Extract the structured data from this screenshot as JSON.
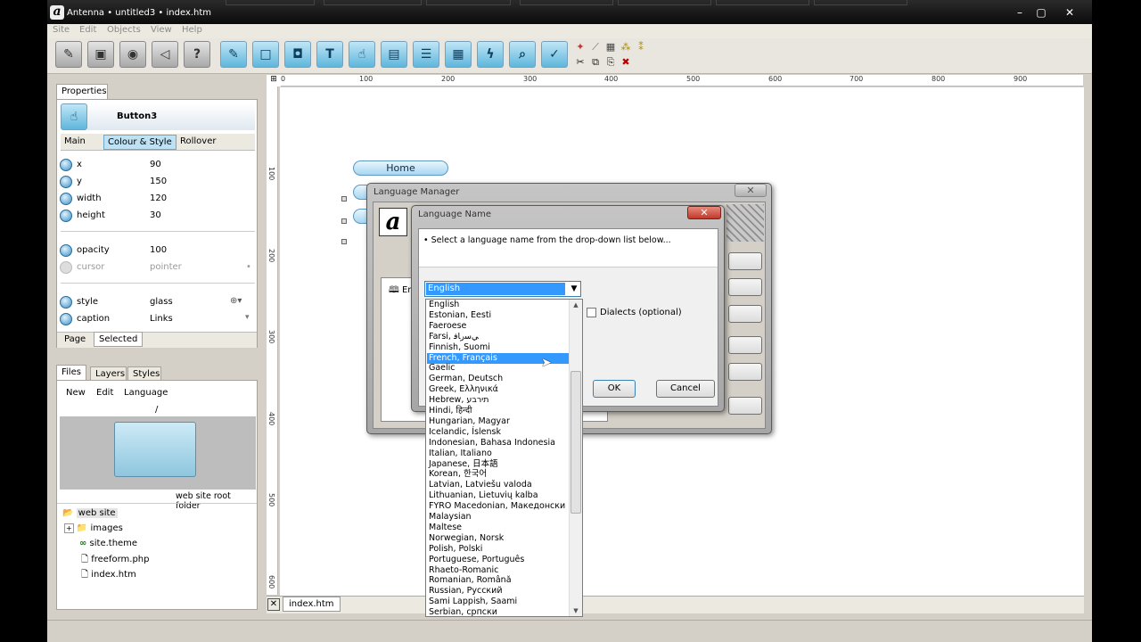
{
  "window": {
    "title": "Antenna • untitled3 • index.htm",
    "controls": [
      "–",
      "▢",
      "✕"
    ]
  },
  "menu": [
    "Site",
    "Edit",
    "Objects",
    "View",
    "Help"
  ],
  "toolbar": {
    "buttons": [
      "publish",
      "save",
      "preview",
      "back",
      "help",
      "pencil",
      "frame",
      "image",
      "text",
      "button",
      "window",
      "list",
      "media",
      "flash",
      "search",
      "form"
    ]
  },
  "properties": {
    "panel_tab": "Properties",
    "object_name": "Button3",
    "tabs": [
      "Main",
      "Colour & Style",
      "Rollover"
    ],
    "rows": [
      {
        "label": "x",
        "value": "90"
      },
      {
        "label": "y",
        "value": "150"
      },
      {
        "label": "width",
        "value": "120"
      },
      {
        "label": "height",
        "value": "30"
      },
      {
        "label": "opacity",
        "value": "100"
      },
      {
        "label": "cursor",
        "value": "pointer"
      },
      {
        "label": "style",
        "value": "glass"
      },
      {
        "label": "caption",
        "value": "Links"
      }
    ],
    "bottom_tabs": [
      "Page",
      "Selected"
    ]
  },
  "files_panel": {
    "tabs": [
      "Files",
      "Layers",
      "Styles"
    ],
    "menu": [
      "New",
      "Edit",
      "Language"
    ],
    "path": "/",
    "folder_caption": "web site root folder",
    "tree": [
      "web site",
      "images",
      "site.theme",
      "freeform.php",
      "index.htm"
    ]
  },
  "ruler": {
    "h": [
      "0",
      "100",
      "200",
      "300",
      "400",
      "500",
      "600",
      "700",
      "800",
      "900"
    ],
    "v": [
      "100",
      "200",
      "300",
      "400",
      "500",
      "600"
    ]
  },
  "canvas": {
    "nav_button": "Home",
    "doc_tab": "index.htm"
  },
  "language_manager": {
    "title": "Language Manager",
    "list_item": "Engl"
  },
  "language_name": {
    "title": "Language Name",
    "instruction": "• Select a language name from the drop-down list below...",
    "selected": "English",
    "dialects_label": "Dialects (optional)",
    "ok": "OK",
    "cancel": "Cancel"
  },
  "languages": [
    "English",
    "Estonian, Eesti",
    "Faeroese",
    "Farsi, ﻲﺳﺭﺎﻓ",
    "Finnish, Suomi",
    "French, Français",
    "Gaelic",
    "German, Deutsch",
    "Greek, Ελληνικά",
    "Hebrew, תירבע",
    "Hindi, हिन्दी",
    "Hungarian, Magyar",
    "Icelandic, Íslensk",
    "Indonesian, Bahasa Indonesia",
    "Italian, Italiano",
    "Japanese, 日本語",
    "Korean, 한국어",
    "Latvian, Latviešu valoda",
    "Lithuanian, Lietuvių kalba",
    "FYRO Macedonian, Македонски",
    "Malaysian",
    "Maltese",
    "Norwegian, Norsk",
    "Polish, Polski",
    "Portuguese, Português",
    "Rhaeto-Romanic",
    "Romanian, Română",
    "Russian, Русский",
    "Sami Lappish, Saami",
    "Serbian, српски"
  ],
  "highlighted_language": "French, Français",
  "colors": {
    "accent": "#3399ff",
    "button_glass": "#a7d6f1",
    "title_bar": "#0a0a0a"
  }
}
